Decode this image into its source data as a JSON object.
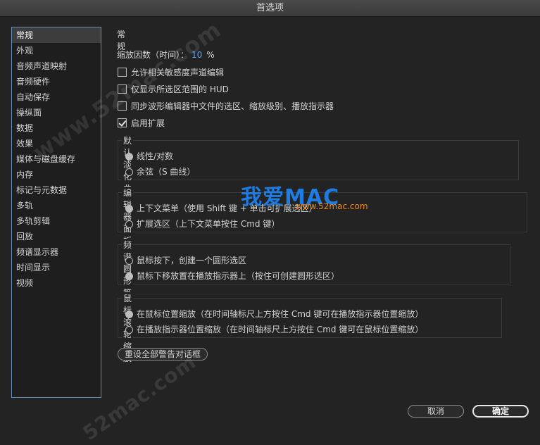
{
  "window": {
    "title": "首选项"
  },
  "sidebar": {
    "items": [
      {
        "label": "常规",
        "selected": true
      },
      {
        "label": "外观"
      },
      {
        "label": "音频声道映射"
      },
      {
        "label": "音频硬件"
      },
      {
        "label": "自动保存"
      },
      {
        "label": "操纵面"
      },
      {
        "label": "数据"
      },
      {
        "label": "效果"
      },
      {
        "label": "媒体与磁盘缓存"
      },
      {
        "label": "内存"
      },
      {
        "label": "标记与元数据"
      },
      {
        "label": "多轨"
      },
      {
        "label": "多轨剪辑"
      },
      {
        "label": "回放"
      },
      {
        "label": "频谱显示器"
      },
      {
        "label": "时间显示"
      },
      {
        "label": "视频"
      }
    ]
  },
  "general": {
    "title": "常规",
    "zoom_label": "缩放因数（时间）：",
    "zoom_value": "10",
    "zoom_unit": "%",
    "checkboxes": [
      {
        "label": "允许相关敏感度声道编辑",
        "checked": false
      },
      {
        "label": "仅显示所选区范围的 HUD",
        "checked": false
      },
      {
        "label": "同步波形编辑器中文件的选区、缩放级别、播放指示器",
        "checked": false
      },
      {
        "label": "启用扩展",
        "checked": true
      }
    ],
    "fade_group": {
      "title": "默认淡化曲线类型",
      "options": [
        {
          "label": "线性/对数",
          "selected": true
        },
        {
          "label": "余弦（S 曲线）",
          "selected": false
        }
      ]
    },
    "editor_group": {
      "title": "编辑器面板关联点击",
      "options": [
        {
          "label": "上下文菜单（使用 Shift 键 + 单击可扩展选区）",
          "selected": true
        },
        {
          "label": "扩展选区（上下文菜单按住 Cmd 键）",
          "selected": false
        }
      ]
    },
    "brush_group": {
      "title": "频谱圆形笔点击",
      "options": [
        {
          "label": "鼠标按下，创建一个圆形选区",
          "selected": false
        },
        {
          "label": "鼠标下移放置在播放指示器上（按住可创建圆形选区）",
          "selected": true
        }
      ]
    },
    "wheel_group": {
      "title": "鼠标滚轮缩放",
      "options": [
        {
          "label": "在鼠标位置缩放（在时间轴标尺上方按住 Cmd 键可在播放指示器位置缩放）",
          "selected": true
        },
        {
          "label": "在播放指示器位置缩放（在时间轴标尺上方按住 Cmd 键可在鼠标位置缩放）",
          "selected": false
        }
      ]
    },
    "reset_button": "重设全部警告对话框"
  },
  "footer": {
    "cancel_label": "取消",
    "ok_label": "确定"
  },
  "watermarks": {
    "site1": "www.52mac.com",
    "site2": "我爱MAC",
    "site3": "www.52mac.com",
    "site4": "52mac.com"
  },
  "colors": {
    "accent": "#4da3ff",
    "watermark_blue": "#1e7be0",
    "watermark_orange": "#f08a1c"
  }
}
